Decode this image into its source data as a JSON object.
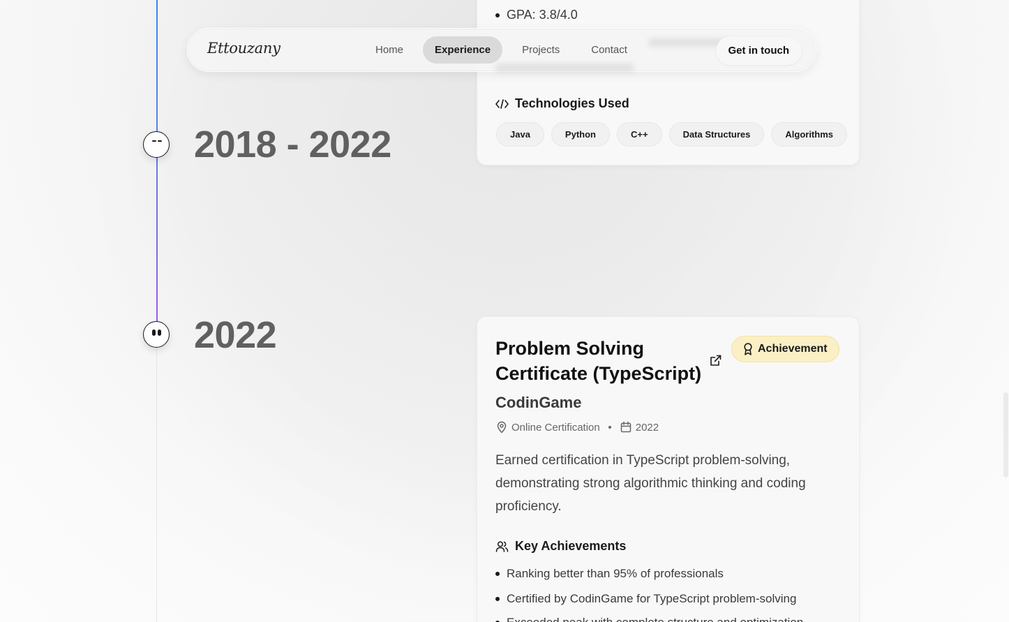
{
  "nav": {
    "logo": "Ettouzany",
    "items": [
      {
        "label": "Home",
        "active": false
      },
      {
        "label": "Experience",
        "active": true
      },
      {
        "label": "Projects",
        "active": false
      },
      {
        "label": "Contact",
        "active": false
      }
    ],
    "cta_label": "Get in touch"
  },
  "timeline": [
    {
      "year": "2018 - 2022",
      "card": {
        "bullet_visible": "GPA: 3.8/4.0",
        "tech_title": "Technologies Used",
        "tech_tags": [
          "Java",
          "Python",
          "C++",
          "Data Structures",
          "Algorithms"
        ]
      }
    },
    {
      "year": "2022",
      "card": {
        "title": "Problem Solving Certificate (TypeScript)",
        "badge": "Achievement",
        "company": "CodinGame",
        "location": "Online Certification",
        "date": "2022",
        "description": "Earned certification in TypeScript problem-solving, demonstrating strong algorithmic thinking and coding proficiency.",
        "achievements_title": "Key Achievements",
        "achievements": [
          "Ranking better than 95% of professionals",
          "Certified by CodinGame for TypeScript problem-solving",
          "Exceeded peak with complete structure and optimization"
        ]
      }
    }
  ],
  "colors": {
    "timeline_start": "#3b82f6",
    "timeline_end": "#a855f7",
    "badge_bg": "#fbefc5",
    "year_text": "#606060"
  },
  "icons": {
    "code": "code-icon",
    "external_link": "external-link-icon",
    "award": "award-icon",
    "location": "map-pin-icon",
    "calendar": "calendar-icon",
    "users": "users-icon"
  }
}
